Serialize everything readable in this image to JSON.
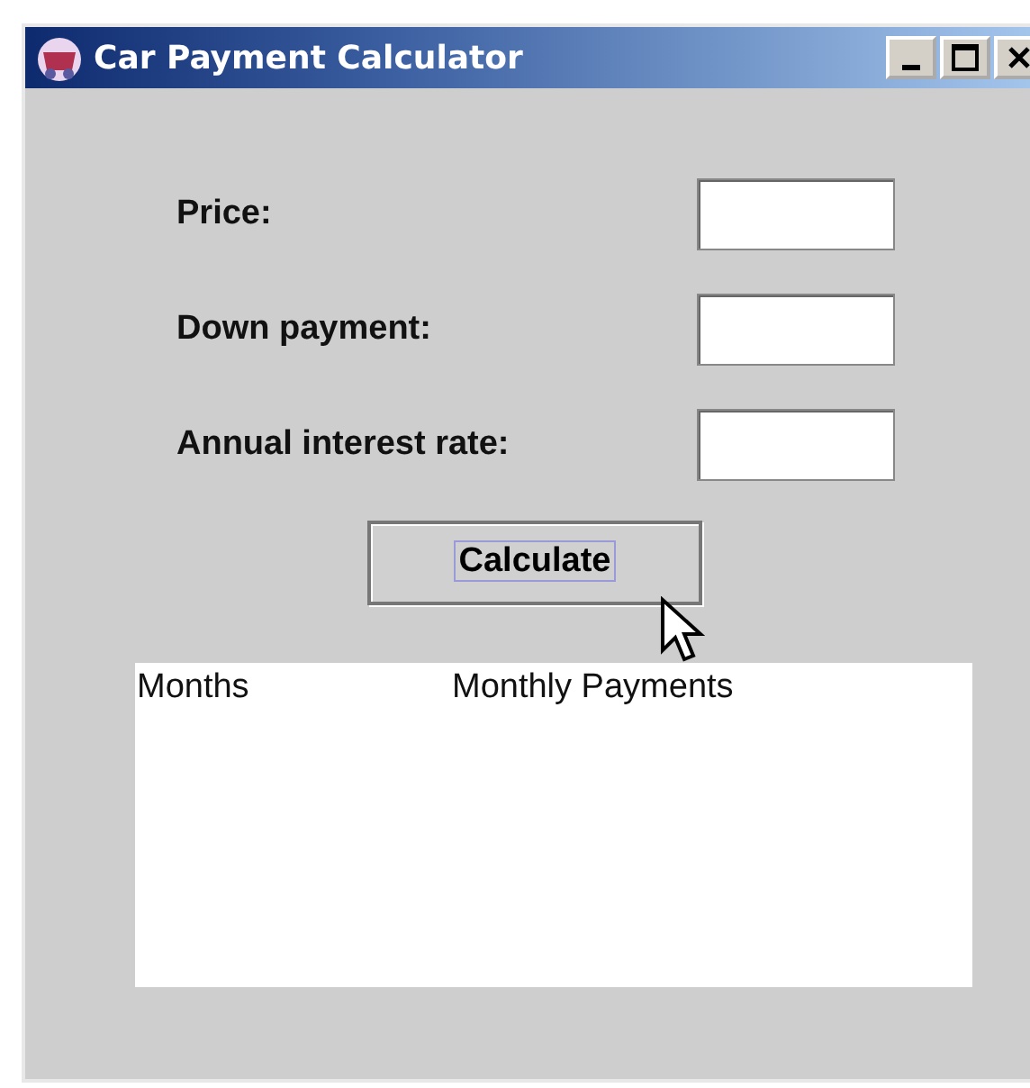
{
  "window": {
    "title": "Car Payment Calculator"
  },
  "fields": [
    {
      "label": "Price:"
    },
    {
      "label": "Down payment:"
    },
    {
      "label": "Annual interest rate:"
    }
  ],
  "button": {
    "label": "Calculate",
    "focused": true
  },
  "output": {
    "columns": [
      "Months",
      "Monthly Payments"
    ]
  }
}
